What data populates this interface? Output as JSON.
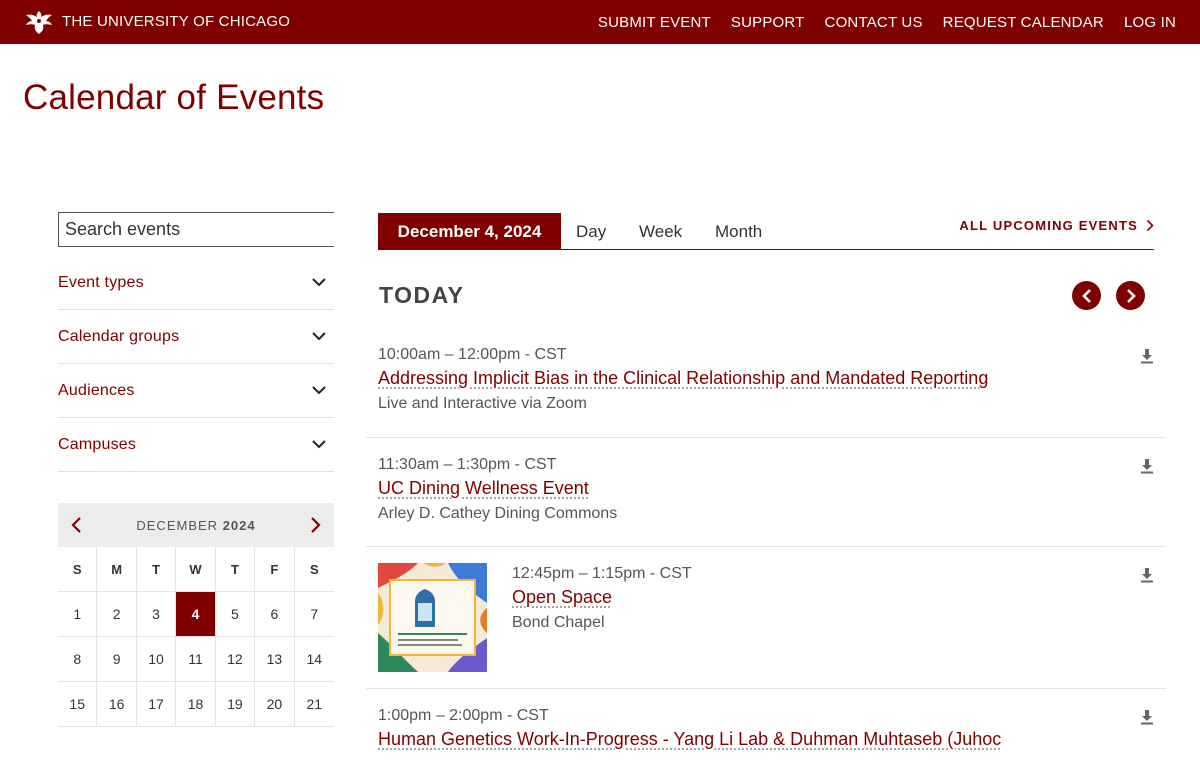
{
  "header": {
    "brand": "THE UNIVERSITY OF CHICAGO",
    "nav": [
      "SUBMIT EVENT",
      "SUPPORT",
      "CONTACT US",
      "REQUEST CALENDAR",
      "LOG IN"
    ]
  },
  "page_title": "Calendar of Events",
  "search": {
    "placeholder": "Search events"
  },
  "filters": [
    "Event types",
    "Calendar groups",
    "Audiences",
    "Campuses"
  ],
  "mini_calendar": {
    "month_label": "DECEMBER",
    "year_label": "2024",
    "weekdays": [
      "S",
      "M",
      "T",
      "W",
      "T",
      "F",
      "S"
    ],
    "days": [
      "1",
      "2",
      "3",
      "4",
      "5",
      "6",
      "7",
      "8",
      "9",
      "10",
      "11",
      "12",
      "13",
      "14",
      "15",
      "16",
      "17",
      "18",
      "19",
      "20",
      "21"
    ],
    "selected_day": "4"
  },
  "view_tabs": {
    "current_date": "December 4, 2024",
    "tabs": [
      "Day",
      "Week",
      "Month"
    ],
    "all_upcoming": "ALL UPCOMING EVENTS"
  },
  "day_heading": "TODAY",
  "events": [
    {
      "time": "10:00am – 12:00pm - CST",
      "title": "Addressing Implicit Bias in the Clinical Relationship and Mandated Reporting",
      "location": "Live and Interactive via Zoom"
    },
    {
      "time": "11:30am – 1:30pm - CST",
      "title": "UC Dining Wellness Event",
      "location": "Arley D. Cathey Dining Commons"
    },
    {
      "time": "12:45pm – 1:15pm - CST",
      "title": "Open Space",
      "location": "Bond Chapel",
      "thumb_text": "Open Space"
    },
    {
      "time": "1:00pm – 2:00pm - CST",
      "title": "Human Genetics Work-In-Progress - Yang Li Lab & Duhman Muhtaseb (Juhoc",
      "location": ""
    }
  ],
  "colors": {
    "brand": "#800000",
    "text": "#333333"
  }
}
